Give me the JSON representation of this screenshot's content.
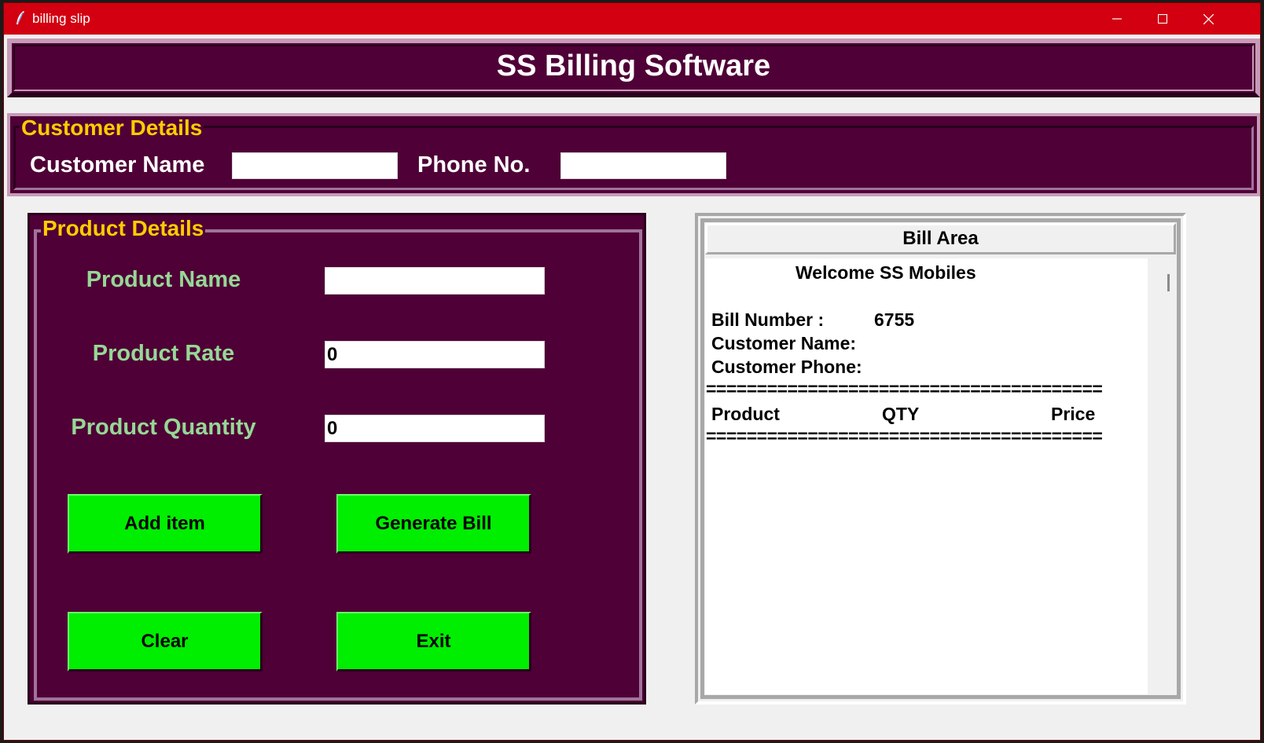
{
  "window": {
    "title": "billing slip",
    "minimize_glyph": "─",
    "maximize_glyph": "☐",
    "close_glyph": "✕"
  },
  "header": {
    "title": "SS Billing Software"
  },
  "customer": {
    "legend": "Customer Details",
    "name_label": "Customer Name",
    "name_value": "",
    "phone_label": "Phone No.",
    "phone_value": ""
  },
  "product": {
    "legend": "Product Details",
    "name_label": "Product Name",
    "name_value": "",
    "rate_label": "Product Rate",
    "rate_value": "0",
    "quantity_label": "Product Quantity",
    "quantity_value": "0",
    "buttons": {
      "add_item": "Add item",
      "generate_bill": "Generate Bill",
      "clear": "Clear",
      "exit": "Exit"
    }
  },
  "bill": {
    "heading": "Bill Area",
    "welcome": "Welcome SS Mobiles",
    "bill_number_label": "Bill Number :",
    "bill_number": "6755",
    "customer_name_label": "Customer Name:",
    "customer_phone_label": "Customer Phone:",
    "separator": "=======================================",
    "col_product": "Product",
    "col_qty": "QTY",
    "col_price": "Price"
  },
  "colors": {
    "titlebar": "#d20011",
    "frame_bg": "#4f0036",
    "legend": "#ffcc00",
    "product_label": "#96d896",
    "button": "#00ee00"
  },
  "icons": {
    "app": "feather-icon",
    "minimize": "minimize-icon",
    "maximize": "maximize-icon",
    "close": "close-icon"
  }
}
